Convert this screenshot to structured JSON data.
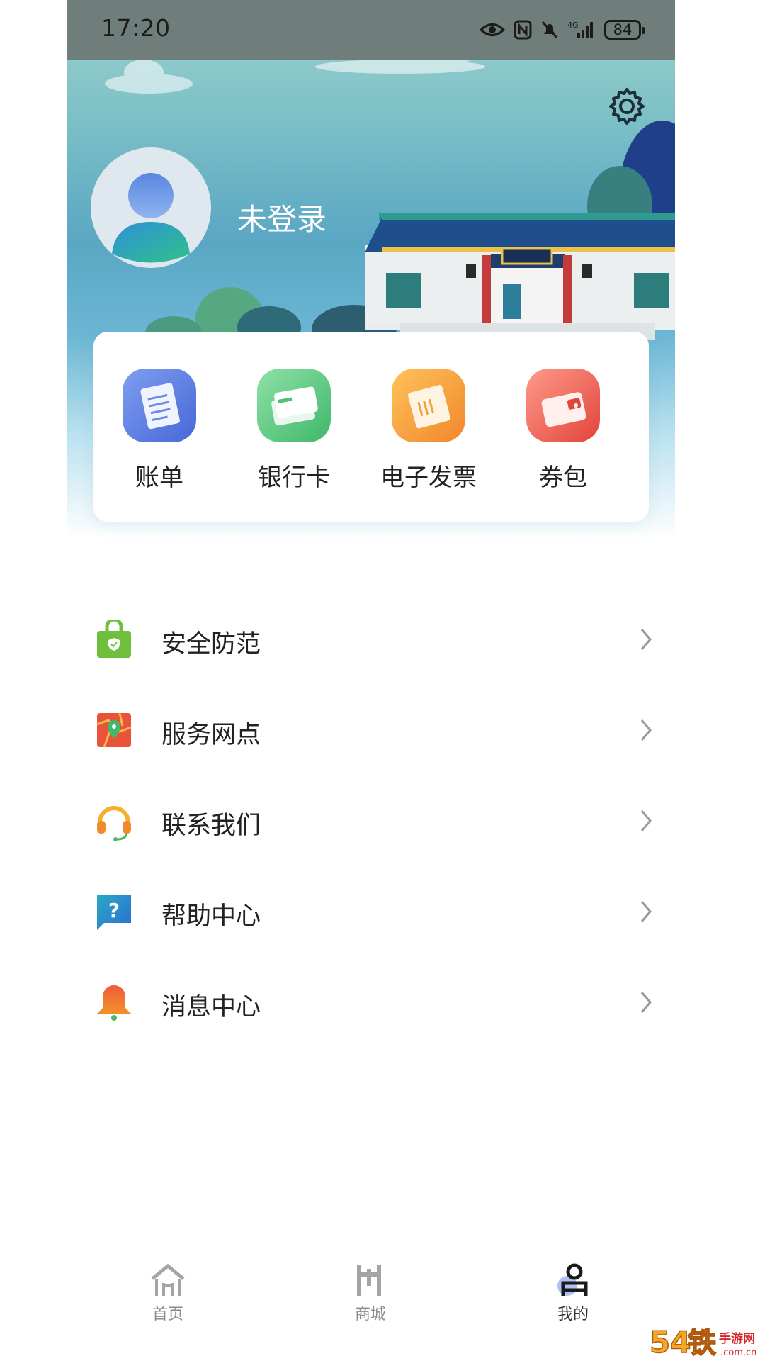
{
  "status_bar": {
    "time": "17:20",
    "battery": "84",
    "network": "4G"
  },
  "header": {
    "login_status": "未登录",
    "settings_icon": "gear-icon"
  },
  "quick_actions": [
    {
      "label": "账单",
      "icon": "bill-icon",
      "color": "#5b7fe0"
    },
    {
      "label": "银行卡",
      "icon": "bank-card-icon",
      "color": "#4cc27a"
    },
    {
      "label": "电子发票",
      "icon": "e-invoice-icon",
      "color": "#f4a23a"
    },
    {
      "label": "券包",
      "icon": "coupon-wallet-icon",
      "color": "#ea5a4e"
    }
  ],
  "menu": [
    {
      "label": "安全防范",
      "icon": "security-bag-icon"
    },
    {
      "label": "服务网点",
      "icon": "map-location-icon"
    },
    {
      "label": "联系我们",
      "icon": "headset-icon"
    },
    {
      "label": "帮助中心",
      "icon": "help-question-icon"
    },
    {
      "label": "消息中心",
      "icon": "bell-icon"
    }
  ],
  "tabbar": [
    {
      "label": "首页",
      "icon": "home-icon",
      "active": false
    },
    {
      "label": "商城",
      "icon": "mall-icon",
      "active": false
    },
    {
      "label": "我的",
      "icon": "profile-icon",
      "active": true
    }
  ],
  "watermark": {
    "text": "54铁手游网",
    "subtext": ".com.cn"
  }
}
